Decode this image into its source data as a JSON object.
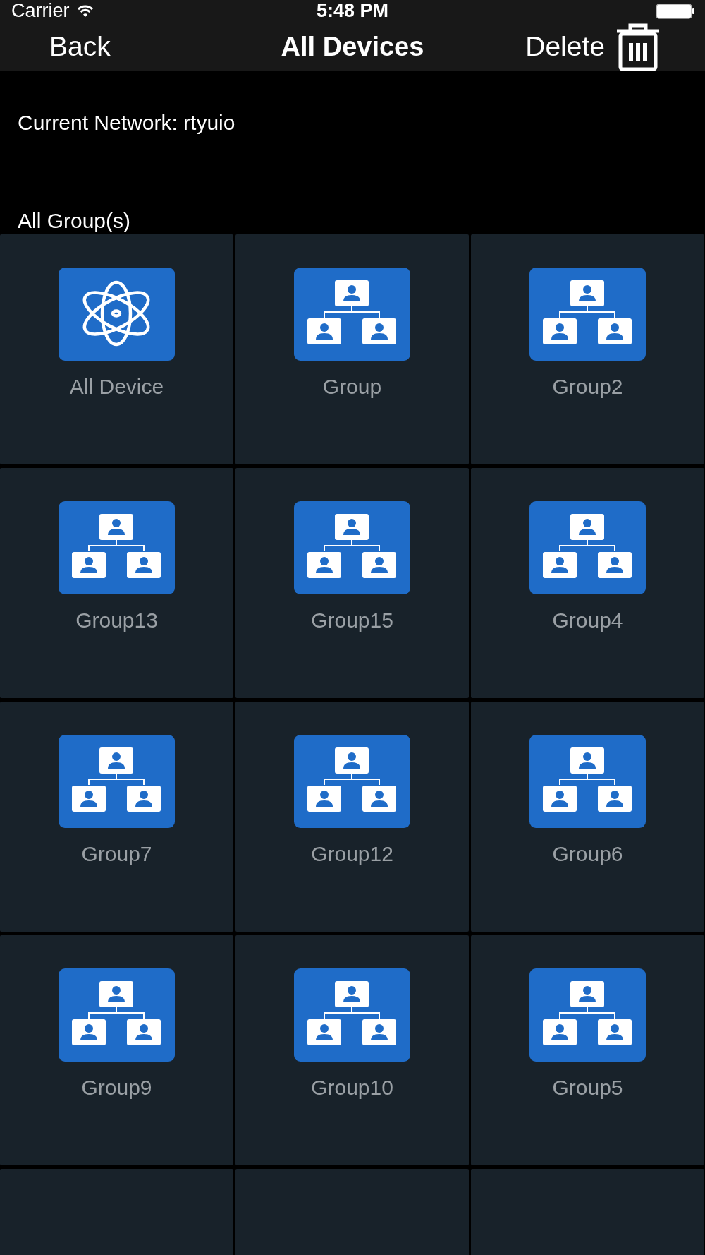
{
  "status_bar": {
    "carrier": "Carrier",
    "time": "5:48 PM"
  },
  "nav_bar": {
    "back": "Back",
    "title": "All Devices",
    "delete": "Delete"
  },
  "network_label": "Current Network: rtyuio",
  "section_title": "All Group(s)",
  "groups": [
    {
      "kind": "all",
      "label": "All Device"
    },
    {
      "kind": "group",
      "label": "Group"
    },
    {
      "kind": "group",
      "label": "Group2"
    },
    {
      "kind": "group",
      "label": "Group13"
    },
    {
      "kind": "group",
      "label": "Group15"
    },
    {
      "kind": "group",
      "label": "Group4"
    },
    {
      "kind": "group",
      "label": "Group7"
    },
    {
      "kind": "group",
      "label": "Group12"
    },
    {
      "kind": "group",
      "label": "Group6"
    },
    {
      "kind": "group",
      "label": "Group9"
    },
    {
      "kind": "group",
      "label": "Group10"
    },
    {
      "kind": "group",
      "label": "Group5"
    },
    {
      "kind": "cut"
    },
    {
      "kind": "cut"
    },
    {
      "kind": "cut"
    }
  ]
}
